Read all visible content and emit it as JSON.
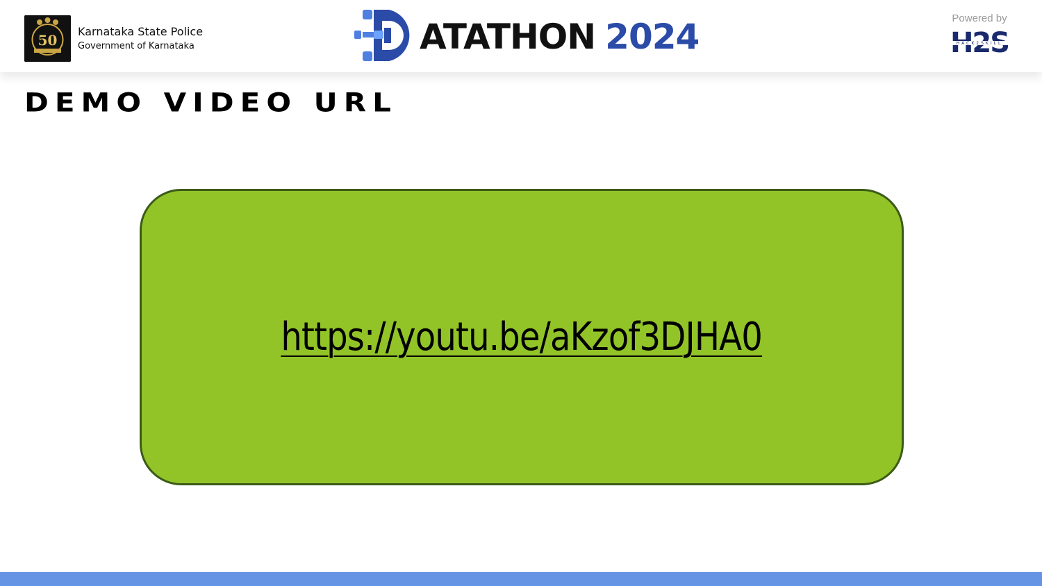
{
  "header": {
    "org_title": "Karnataka State Police",
    "org_subtitle": "Government of Karnataka",
    "event_word": "ATATHON",
    "event_year": "2024",
    "powered_label": "Powered by",
    "sponsor_logo_icon": "h2s-hack2skill-logo",
    "sponsor_logo_text": "H2S",
    "sponsor_logo_subtext": "HACK2SKILL",
    "org_badge_text": "50"
  },
  "slide": {
    "heading": "DEMO VIDEO URL",
    "url": "https://youtu.be/aKzof3DJHA0"
  },
  "colors": {
    "box_fill": "#92c428",
    "box_border": "#3c5a18",
    "event_year": "#2b4ba8",
    "footer_bar": "#6594e4"
  }
}
